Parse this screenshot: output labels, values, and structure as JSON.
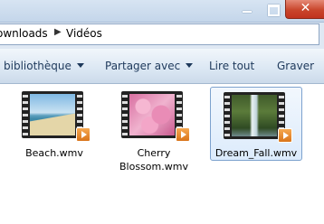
{
  "window": {
    "close_glyph": "✕"
  },
  "breadcrumb": {
    "items": [
      "ownloads",
      "Vidéos"
    ],
    "separator": "▶"
  },
  "toolbar": {
    "items": [
      {
        "label": "bibliothèque",
        "has_menu": true
      },
      {
        "label": "Partager avec",
        "has_menu": true
      },
      {
        "label": "Lire tout",
        "has_menu": false
      },
      {
        "label": "Graver",
        "has_menu": false
      }
    ]
  },
  "files": [
    {
      "name": "Beach.wmv",
      "icon": "video-file-icon",
      "selected": false
    },
    {
      "name": "Cherry Blossom.wmv",
      "name_line1": "Cherry",
      "name_line2": "Blossom.wmv",
      "icon": "video-file-icon",
      "selected": false
    },
    {
      "name": "Dream_Fall.wmv",
      "icon": "video-file-icon",
      "selected": true
    }
  ],
  "colors": {
    "accent": "#1e395b",
    "close_button": "#c9462c",
    "selection": "#dcebfc",
    "play_badge": "#e68a2e"
  }
}
